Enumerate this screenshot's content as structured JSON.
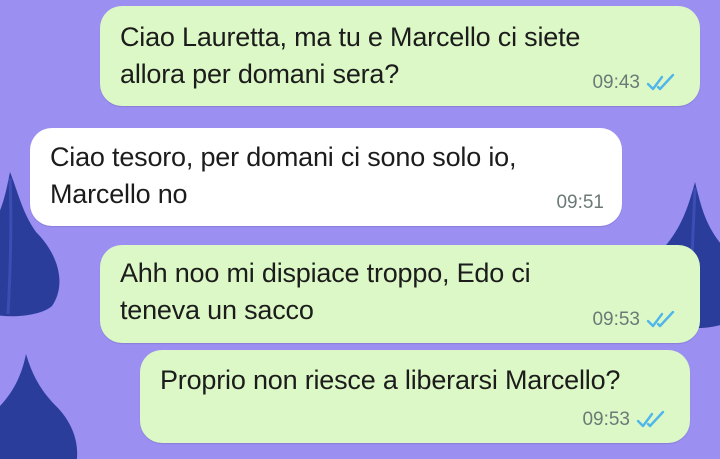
{
  "theme": {
    "wallpaper": "#9b8ff2",
    "outgoing_bubble": "#dcf8c6",
    "incoming_bubble": "#ffffff",
    "read_ticks": "#4fb6ec",
    "timestamp": "#6c7a77"
  },
  "messages": [
    {
      "direction": "outgoing",
      "text": "Ciao Lauretta, ma tu e Marcello ci siete\nallora per domani sera?",
      "time": "09:43",
      "status": "read",
      "status_icon": "double-check-icon"
    },
    {
      "direction": "incoming",
      "text": "Ciao tesoro, per domani ci sono solo io,\nMarcello no",
      "time": "09:51"
    },
    {
      "direction": "outgoing",
      "text": "Ahh noo mi dispiace troppo, Edo ci\nteneva un sacco",
      "time": "09:53",
      "status": "read",
      "status_icon": "double-check-icon"
    },
    {
      "direction": "outgoing",
      "text": "Proprio non riesce a liberarsi Marcello?",
      "time": "09:53",
      "status": "read",
      "status_icon": "double-check-icon"
    }
  ]
}
